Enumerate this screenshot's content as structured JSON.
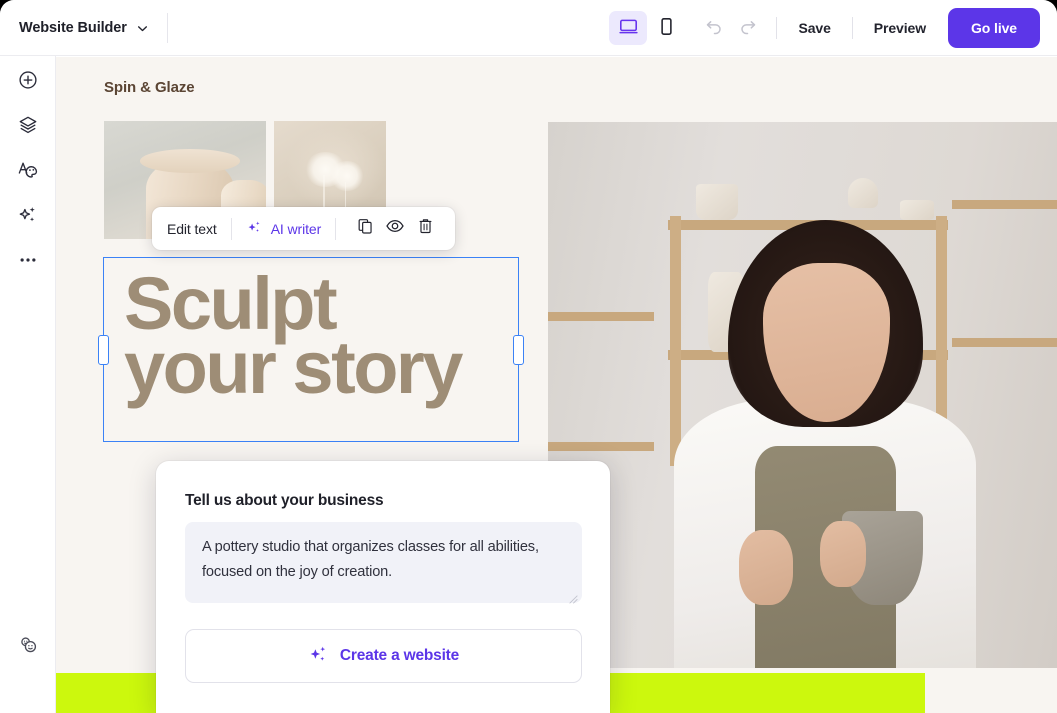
{
  "window": {
    "title": "Website Builder"
  },
  "topbar": {
    "brand_label": "Website Builder",
    "brand_caret": "chevron-down",
    "device_desktop": "desktop-view",
    "device_mobile": "mobile-view",
    "undo": "undo",
    "redo": "redo",
    "save_label": "Save",
    "preview_label": "Preview",
    "golive_label": "Go live",
    "accent": "#5c36e8",
    "active_bg": "#ece9fd"
  },
  "rail": {
    "items": [
      {
        "name": "add-element",
        "icon": "plus-circle-icon"
      },
      {
        "name": "layers",
        "icon": "layers-icon"
      },
      {
        "name": "design",
        "icon": "font-palette-icon"
      },
      {
        "name": "ai-tools",
        "icon": "sparkles-icon"
      },
      {
        "name": "more",
        "icon": "ellipsis-icon"
      }
    ],
    "bottom": {
      "name": "collaborators",
      "icon": "faces-icon"
    }
  },
  "canvas": {
    "background": "#f8f5f1",
    "site_logo": "Spin & Glaze",
    "headline": "Sculpt\nyour story",
    "headline_color": "#9e8d76",
    "accent_band_color": "#ccf80d",
    "images": [
      {
        "name": "thumbnail-pottery-vases",
        "alt": "Two pale clay vases"
      },
      {
        "name": "thumbnail-dried-flowers",
        "alt": "Two dried white flowers"
      },
      {
        "name": "hero-photo",
        "alt": "Woman in a pottery studio holding a clay bowl"
      }
    ]
  },
  "text_toolbar": {
    "edit_text_label": "Edit text",
    "ai_writer_label": "AI writer",
    "ai_writer_color": "#5c36e8",
    "duplicate": "duplicate-icon",
    "hide": "eye-icon",
    "delete": "trash-icon"
  },
  "modal": {
    "title": "Tell us about your business",
    "textarea_value": "A pottery studio that organizes classes for all abilities, focused on the joy of creation.",
    "textarea_placeholder": "Tell us about your business",
    "create_label": "Create a website",
    "create_icon": "sparkles-icon"
  }
}
